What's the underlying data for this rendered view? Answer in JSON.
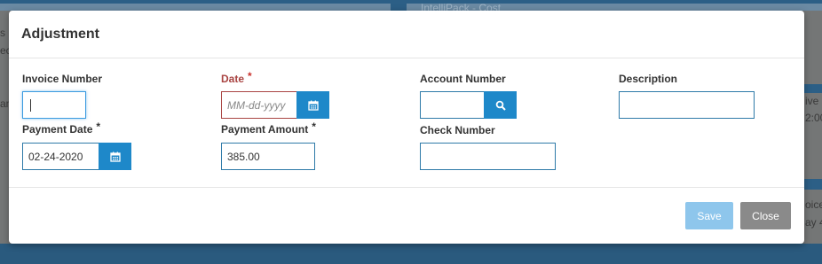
{
  "background": {
    "top_text": "IntelliPack - Cost",
    "left_fragments": [
      "s",
      "ec",
      "am"
    ],
    "right_fragments": [
      "ive",
      "2:00",
      "oice",
      "ay 4"
    ]
  },
  "modal": {
    "title": "Adjustment",
    "fields": {
      "invoice_number": {
        "label": "Invoice Number",
        "value": ""
      },
      "date": {
        "label": "Date",
        "required_mark": "*",
        "placeholder": "MM-dd-yyyy",
        "value": ""
      },
      "account_number": {
        "label": "Account Number",
        "value": ""
      },
      "description": {
        "label": "Description",
        "value": ""
      },
      "payment_date": {
        "label": "Payment Date",
        "required_mark": "*",
        "value": "02-24-2020"
      },
      "payment_amount": {
        "label": "Payment Amount",
        "required_mark": "*",
        "value": "385.00"
      },
      "check_number": {
        "label": "Check Number",
        "value": ""
      }
    },
    "buttons": {
      "save": "Save",
      "close": "Close"
    }
  },
  "colors": {
    "accent": "#1e88c9",
    "error": "#a94442",
    "save_disabled": "#8ec6ec",
    "close": "#8a8a8a"
  },
  "icons": {
    "calendar": "calendar-icon",
    "search": "search-icon"
  }
}
